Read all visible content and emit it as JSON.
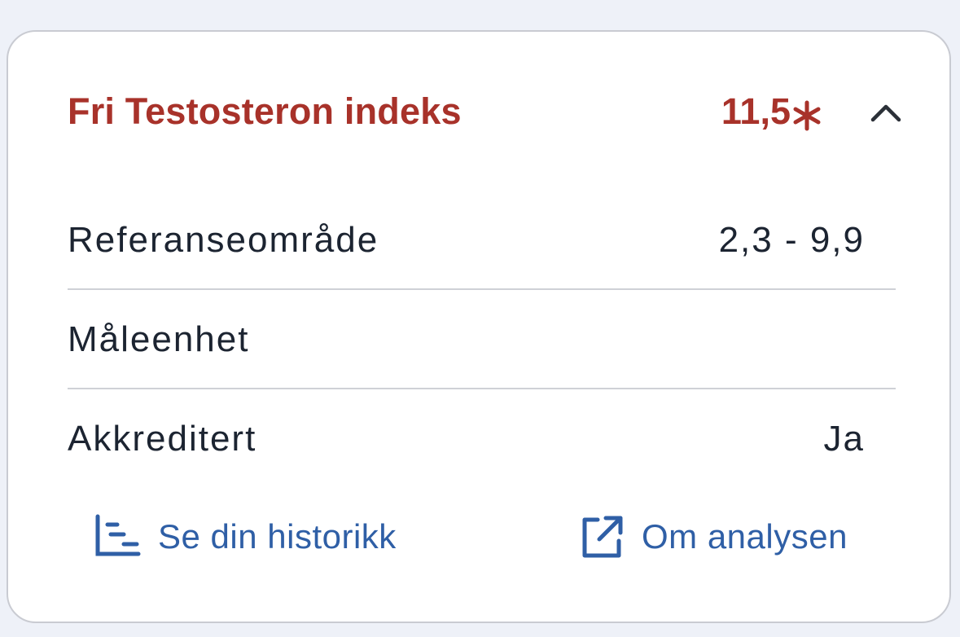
{
  "analysis": {
    "title": "Fri Testosteron indeks",
    "value": "11,5",
    "flag_icon": "asterisk-icon",
    "collapse_icon": "chevron-up-icon",
    "accent_color": "#a8322a"
  },
  "details": {
    "rows": [
      {
        "label": "Referanseområde",
        "value": "2,3 - 9,9"
      },
      {
        "label": "Måleenhet",
        "value": ""
      },
      {
        "label": "Akkreditert",
        "value": "Ja"
      }
    ]
  },
  "links": {
    "history": {
      "label": "Se din historikk",
      "icon": "history-chart-icon"
    },
    "about": {
      "label": "Om analysen",
      "icon": "external-link-icon"
    },
    "link_color": "#2f5fa6"
  }
}
